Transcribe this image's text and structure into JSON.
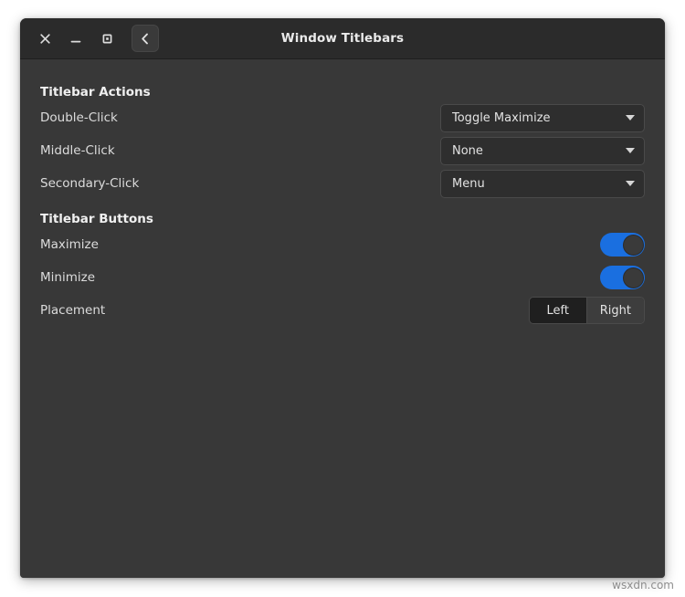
{
  "window": {
    "title": "Window Titlebars",
    "controls": {
      "close_label": "×",
      "minimize_label": "_",
      "maximize_label": "□",
      "back_label": "‹"
    }
  },
  "sections": [
    {
      "title": "Titlebar Actions",
      "rows": [
        {
          "label": "Double-Click",
          "control": "dropdown",
          "value": "Toggle Maximize"
        },
        {
          "label": "Middle-Click",
          "control": "dropdown",
          "value": "None"
        },
        {
          "label": "Secondary-Click",
          "control": "dropdown",
          "value": "Menu"
        }
      ]
    },
    {
      "title": "Titlebar Buttons",
      "rows": [
        {
          "label": "Maximize",
          "control": "switch",
          "value": "on"
        },
        {
          "label": "Minimize",
          "control": "switch",
          "value": "on"
        },
        {
          "label": "Placement",
          "control": "segmented",
          "options": [
            "Left",
            "Right"
          ],
          "selected": "Right"
        }
      ]
    }
  ],
  "watermark": "wsxdn.com",
  "colors": {
    "window_bg": "#383838",
    "titlebar_bg": "#2b2b2b",
    "accent": "#1a6fe0",
    "text": "#dcdcdc"
  }
}
